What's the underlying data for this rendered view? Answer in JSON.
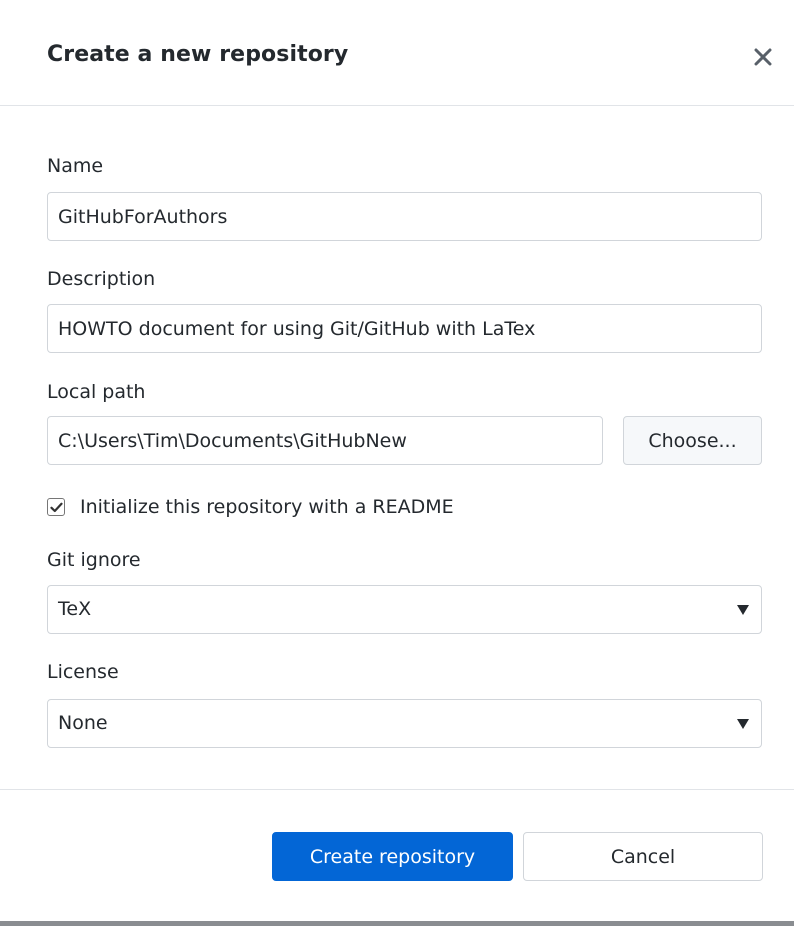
{
  "dialog": {
    "title": "Create a new repository",
    "close_icon": "close-icon"
  },
  "name": {
    "label": "Name",
    "value": "GitHubForAuthors"
  },
  "description": {
    "label": "Description",
    "value": "HOWTO document for using Git/GitHub with LaTex"
  },
  "local_path": {
    "label": "Local path",
    "value": "C:\\Users\\Tim\\Documents\\GitHubNew",
    "choose_label": "Choose..."
  },
  "readme": {
    "label": "Initialize this repository with a README",
    "checked": true
  },
  "git_ignore": {
    "label": "Git ignore",
    "selected": "TeX"
  },
  "license": {
    "label": "License",
    "selected": "None"
  },
  "actions": {
    "create_label": "Create repository",
    "cancel_label": "Cancel"
  },
  "colors": {
    "primary": "#0366d6",
    "text": "#24292e",
    "border": "#d1d5da"
  }
}
